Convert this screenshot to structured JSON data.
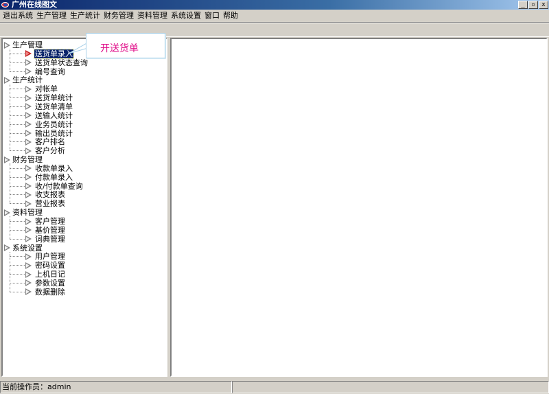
{
  "window": {
    "title": "广州在线图文",
    "controls": {
      "minimize": "_",
      "restore": "▫",
      "close": "x"
    }
  },
  "menu": [
    "退出系统",
    "生产管理",
    "生产统计",
    "财务管理",
    "资料管理",
    "系统设置",
    "窗口",
    "帮助"
  ],
  "tree": [
    {
      "label": "生产管理",
      "children": [
        "送货单录入",
        "送货单状态查询",
        "编号查询"
      ]
    },
    {
      "label": "生产统计",
      "children": [
        "对帐单",
        "送货单统计",
        "送货单清单",
        "送输人统计",
        "业务员统计",
        "输出员统计",
        "客户排名",
        "客户分析"
      ]
    },
    {
      "label": "财务管理",
      "children": [
        "收款单录入",
        "付款单录入",
        "收/付款单查询",
        "收支报表",
        "营业报表"
      ]
    },
    {
      "label": "资料管理",
      "children": [
        "客户管理",
        "基价管理",
        "词典管理"
      ]
    },
    {
      "label": "系统设置",
      "children": [
        "用户管理",
        "密码设置",
        "上机日记",
        "参数设置",
        "数据删除"
      ]
    }
  ],
  "selected_item": "送货单录入",
  "tooltip": {
    "text": "开送货单"
  },
  "status": {
    "operator_label": "当前操作员：",
    "operator_name": "admin"
  },
  "colors": {
    "title_bar": "#0a246a",
    "selection": "#0a246a",
    "tooltip_text": "#e0108a",
    "window_face": "#d4d0c8"
  }
}
